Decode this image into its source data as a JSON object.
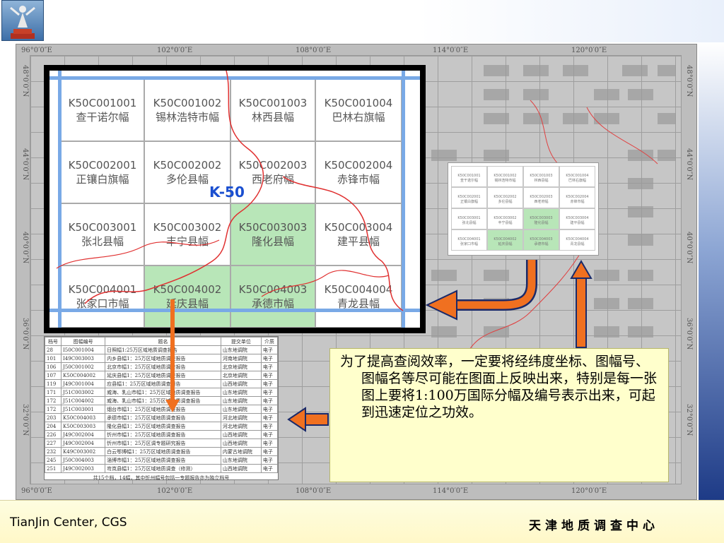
{
  "header": {
    "logo_icon": "statue-logo-icon"
  },
  "map": {
    "top_coords": [
      "96°0′0″E",
      "102°0′0″E",
      "108°0′0″E",
      "114°0′0″E",
      "120°0′0″E"
    ],
    "bottom_coords": [
      "96°0′0″E",
      "102°0′0″E",
      "108°0′0″E",
      "114°0′0″E",
      "120°0′0″E"
    ],
    "left_coords": [
      "48°0′0″N",
      "44°0′0″N",
      "40°0′0″N",
      "36°0′0″N",
      "32°0′0″N"
    ],
    "right_coords": [
      "48°0′0″N",
      "44°0′0″N",
      "40°0′0″N",
      "36°0′0″N",
      "32°0′0″N"
    ]
  },
  "zoom": {
    "sheet_label": "K-50",
    "cells": [
      {
        "code": "K50C001001",
        "name": "查干诺尔幅",
        "green": false
      },
      {
        "code": "K50C001002",
        "name": "锡林浩特市幅",
        "green": false
      },
      {
        "code": "K50C001003",
        "name": "林西县幅",
        "green": false
      },
      {
        "code": "K50C001004",
        "name": "巴林右旗幅",
        "green": false
      },
      {
        "code": "K50C002001",
        "name": "正镶白旗幅",
        "green": false
      },
      {
        "code": "K50C002002",
        "name": "多伦县幅",
        "green": false
      },
      {
        "code": "K50C002003",
        "name": "西老府幅",
        "green": false
      },
      {
        "code": "K50C002004",
        "name": "赤锋市幅",
        "green": false
      },
      {
        "code": "K50C003001",
        "name": "张北县幅",
        "green": false
      },
      {
        "code": "K50C003002",
        "name": "丰宁县幅",
        "green": false
      },
      {
        "code": "K50C003003",
        "name": "隆化县幅",
        "green": true
      },
      {
        "code": "K50C003004",
        "name": "建平县幅",
        "green": false
      },
      {
        "code": "K50C004001",
        "name": "张家口市幅",
        "green": false
      },
      {
        "code": "K50C004002",
        "name": "延庆县幅",
        "green": true
      },
      {
        "code": "K50C004003",
        "name": "承德市幅",
        "green": true
      },
      {
        "code": "K50C004004",
        "name": "青龙县幅",
        "green": false
      }
    ]
  },
  "table": {
    "headers": [
      "档号",
      "图幅编号",
      "题名",
      "提交单位",
      "介质"
    ],
    "rows": [
      [
        "28",
        "I50C001004",
        "日照幅1:25万区域地质调查报告",
        "山东地调院",
        "电子"
      ],
      [
        "101",
        "I49C003003",
        "内乡县幅1：25万区域地质调查报告",
        "河南地调院",
        "电子"
      ],
      [
        "106",
        "J50C001002",
        "北京市幅1：25万区域地质调查报告",
        "北京地调院",
        "电子"
      ],
      [
        "107",
        "K50C004002",
        "延庆县幅1：25万区域地质调查报告",
        "北京地调院",
        "电子"
      ],
      [
        "119",
        "J49C001004",
        "应县幅1：25万区域地质调查报告",
        "山西地调院",
        "电子"
      ],
      [
        "171",
        "J51C003002",
        "威海、乳山市幅1：25万区域地质调查报告",
        "山东地调院",
        "电子"
      ],
      [
        "172",
        "J51C004002",
        "威海、乳山市幅1：25万区域地质调查报告",
        "山东地调院",
        "电子"
      ],
      [
        "172",
        "J51C003001",
        "烟台市幅1：25万区域地质调查报告",
        "山东地调院",
        "电子"
      ],
      [
        "203",
        "K50C004003",
        "承德市幅1：25万区域地质调查报告",
        "河北地调院",
        "电子"
      ],
      [
        "204",
        "K50C003003",
        "隆化县幅1：25万区域地质调查报告",
        "河北地调院",
        "电子"
      ],
      [
        "226",
        "J49C002004",
        "忻州市幅1：25万区域地质调查报告",
        "山西地调院",
        "电子"
      ],
      [
        "227",
        "J49C002004",
        "忻州市幅1：25万区调专题研究报告",
        "山西地调院",
        "电子"
      ],
      [
        "232",
        "K49C003002",
        "白云鄂博幅1：25万区域地质调查报告",
        "内蒙古地调院",
        "电子"
      ],
      [
        "245",
        "J50C004003",
        "淄博市幅1：25万区域地质调查报告",
        "山东地调院",
        "电子"
      ],
      [
        "251",
        "J49C002003",
        "岢岚县幅1：25万区域地质调查（修测）",
        "山西地调院",
        "电子"
      ]
    ],
    "footer": "共15个档，14幅，其中忻州幅号包括一专题报告亦为独立档号"
  },
  "note": {
    "text": "为了提高查阅效率，一定要将经纬度坐标、图幅号、图幅名等尽可能在图面上反映出来，特别是每一张图上要将1:100万国际分幅及编号表示出来，可起到迅速定位之功效。"
  },
  "footer": {
    "left": "TianJin Center, CGS",
    "right": "天津地质调查中心"
  },
  "colors": {
    "arrow": "#f07020",
    "arrow_outline": "#1a2a6a",
    "highlight": "#b8e6b8",
    "note_bg": "#ffffcc",
    "river": "#e03030"
  }
}
